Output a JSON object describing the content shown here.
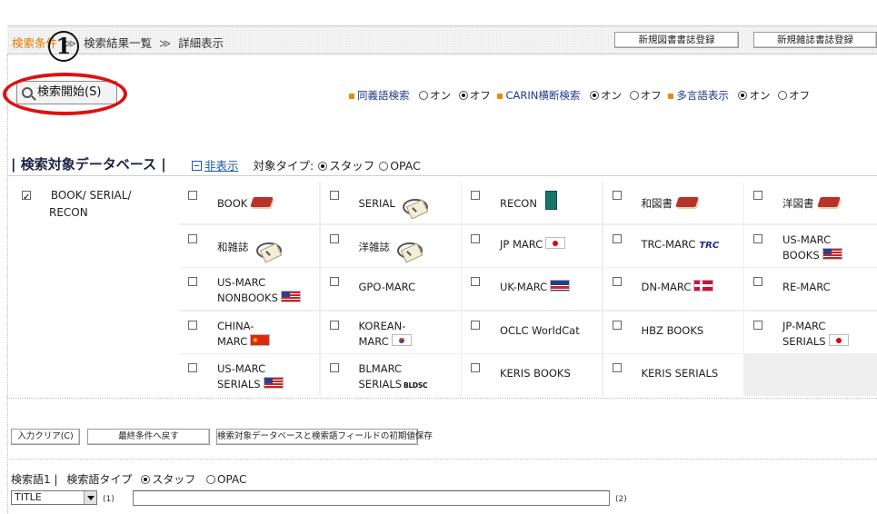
{
  "breadcrumb": {
    "step1": "検索条件",
    "sep": "≫",
    "step2": "検索結果一覧",
    "step3": "詳細表示"
  },
  "header_buttons": {
    "new_book": "新規図書書誌登録",
    "new_serial": "新規雑誌書誌登録"
  },
  "callout": {
    "number": "1"
  },
  "search_button": "検索開始(S)",
  "options": {
    "synonym": {
      "label": "同義語検索",
      "on": "オン",
      "off": "オフ",
      "selected": "off"
    },
    "carin": {
      "label": "CARIN横断検索",
      "on": "オン",
      "off": "オフ",
      "selected": "on"
    },
    "multilang": {
      "label": "多言語表示",
      "on": "オン",
      "off": "オフ",
      "selected": "on"
    }
  },
  "section": {
    "title": "検索対象データベース",
    "bar": "|",
    "hide_link": "非表示",
    "target_type_label": "対象タイプ:",
    "staff": "スタッフ",
    "opac": "OPAC",
    "selected": "staff"
  },
  "group": {
    "label_line1": "BOOK/ SERIAL/",
    "label_line2": "RECON",
    "checked": true
  },
  "databases": [
    {
      "line1": "BOOK",
      "line2": "",
      "icon": "red-book-icon"
    },
    {
      "line1": "SERIAL",
      "line2": "",
      "icon": "magazine-icon"
    },
    {
      "line1": "RECON",
      "line2": "",
      "icon": "green-book-icon"
    },
    {
      "line1": "和図書",
      "line2": "",
      "icon": "red-book-icon"
    },
    {
      "line1": "洋図書",
      "line2": "",
      "icon": "red-book-icon"
    },
    {
      "line1": "和雑誌",
      "line2": "",
      "icon": "magazine-icon"
    },
    {
      "line1": "洋雑誌",
      "line2": "",
      "icon": "magazine-icon"
    },
    {
      "line1": "JP MARC",
      "line2": "",
      "icon": "japan-flag-icon"
    },
    {
      "line1": "TRC-MARC",
      "line2": "",
      "icon": "trc-logo",
      "badge": "TRC"
    },
    {
      "line1": "US-MARC",
      "line2": "BOOKS",
      "icon": "us-flag-icon"
    },
    {
      "line1": "US-MARC",
      "line2": "NONBOOKS",
      "icon": "us-flag-icon"
    },
    {
      "line1": "GPO-MARC",
      "line2": "",
      "icon": ""
    },
    {
      "line1": "UK-MARC",
      "line2": "",
      "icon": "uk-flag-icon"
    },
    {
      "line1": "DN-MARC",
      "line2": "",
      "icon": "denmark-flag-icon"
    },
    {
      "line1": "RE-MARC",
      "line2": "",
      "icon": ""
    },
    {
      "line1": "CHINA-",
      "line2": "MARC",
      "icon": "china-flag-icon"
    },
    {
      "line1": "KOREAN-",
      "line2": "MARC",
      "icon": "korea-flag-icon"
    },
    {
      "line1": "OCLC WorldCat",
      "line2": "",
      "icon": ""
    },
    {
      "line1": "HBZ BOOKS",
      "line2": "",
      "icon": ""
    },
    {
      "line1": "JP-MARC",
      "line2": "SERIALS",
      "icon": "japan-flag-icon"
    },
    {
      "line1": "US-MARC",
      "line2": "SERIALS",
      "icon": "us-flag-icon"
    },
    {
      "line1": "BLMARC",
      "line2": "SERIALS",
      "icon": "bldsc-logo",
      "badge": "BLDSC"
    },
    {
      "line1": "KERIS BOOKS",
      "line2": "",
      "icon": ""
    },
    {
      "line1": "KERIS SERIALS",
      "line2": "",
      "icon": ""
    }
  ],
  "lower_buttons": {
    "clear": "入力クリア(C)",
    "restore": "最終条件へ戻す",
    "save_default": "検索対象データベースと検索語フィールドの初期値保存"
  },
  "keyword": {
    "label": "検索語1",
    "bar": "|",
    "type_label": "検索語タイプ",
    "staff": "スタッフ",
    "opac": "OPAC",
    "selected": "staff",
    "field_value": "TITLE",
    "idx1": "(1)",
    "idx2": "(2)",
    "text_value": ""
  },
  "colors": {
    "accent_orange": "#e07b00",
    "callout_red": "#e01010",
    "link_blue": "#1a56a6"
  }
}
